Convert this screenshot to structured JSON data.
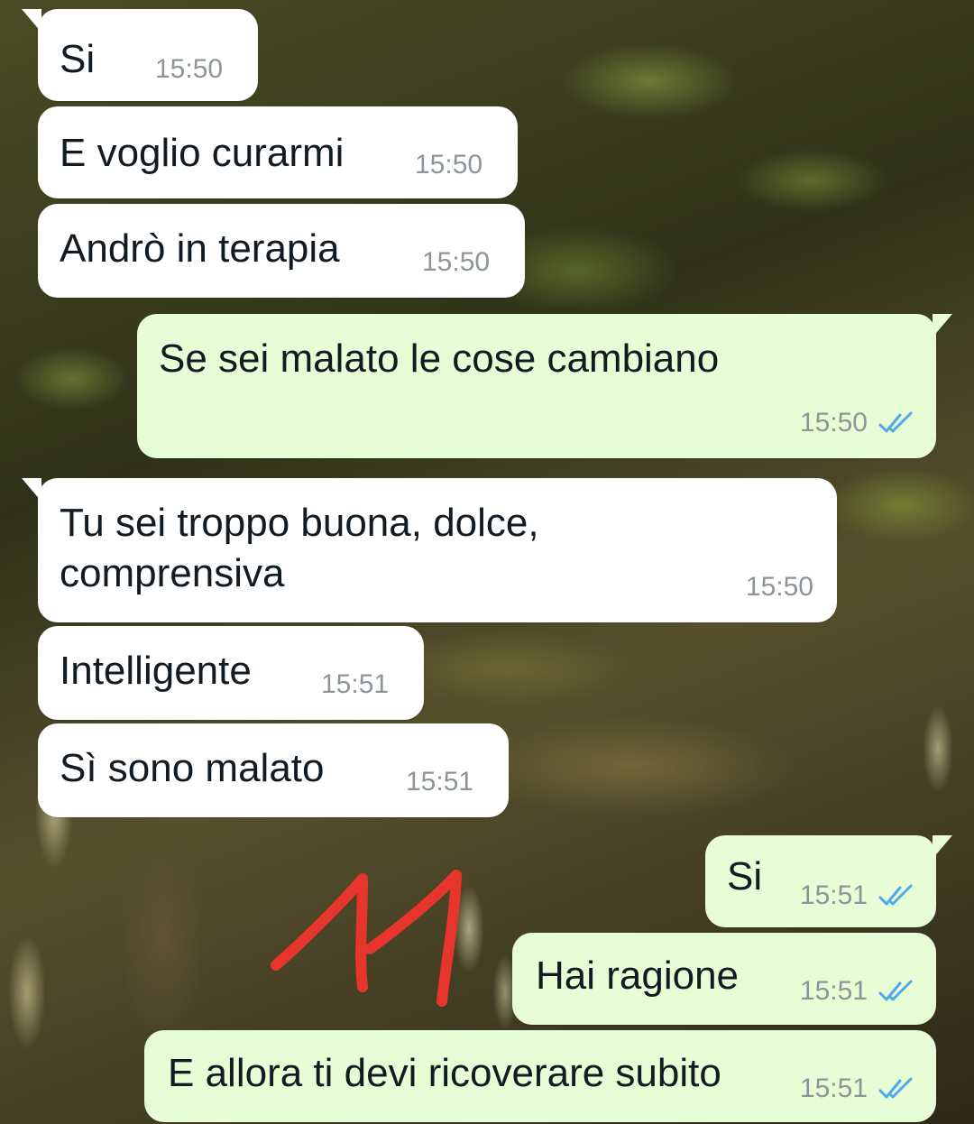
{
  "messages": [
    {
      "dir": "in",
      "text": "Si",
      "time": "15:50"
    },
    {
      "dir": "in",
      "text": "E voglio curarmi",
      "time": "15:50"
    },
    {
      "dir": "in",
      "text": "Andrò in terapia",
      "time": "15:50"
    },
    {
      "dir": "out",
      "text": "Se sei malato le cose cambiano",
      "time": "15:50",
      "status": "read"
    },
    {
      "dir": "in",
      "text_line1": "Tu sei troppo buona, dolce,",
      "text_line2": "comprensiva",
      "time": "15:50"
    },
    {
      "dir": "in",
      "text": "Intelligente",
      "time": "15:51"
    },
    {
      "dir": "in",
      "text": "Sì sono malato",
      "time": "15:51"
    },
    {
      "dir": "out",
      "text": "Si",
      "time": "15:51",
      "status": "read"
    },
    {
      "dir": "out",
      "text": "Hai ragione",
      "time": "15:51",
      "status": "read"
    },
    {
      "dir": "out",
      "text": "E allora ti devi ricoverare subito",
      "time": "15:51",
      "status": "read"
    }
  ],
  "annotation": {
    "text": "11",
    "color": "#e8352c"
  },
  "colors": {
    "incoming_bubble": "#ffffff",
    "outgoing_bubble": "#e7fdd6",
    "read_tick": "#4fa9e8",
    "time_text": "#8d9599"
  },
  "icons": {
    "read_receipt": "double-check-icon"
  }
}
